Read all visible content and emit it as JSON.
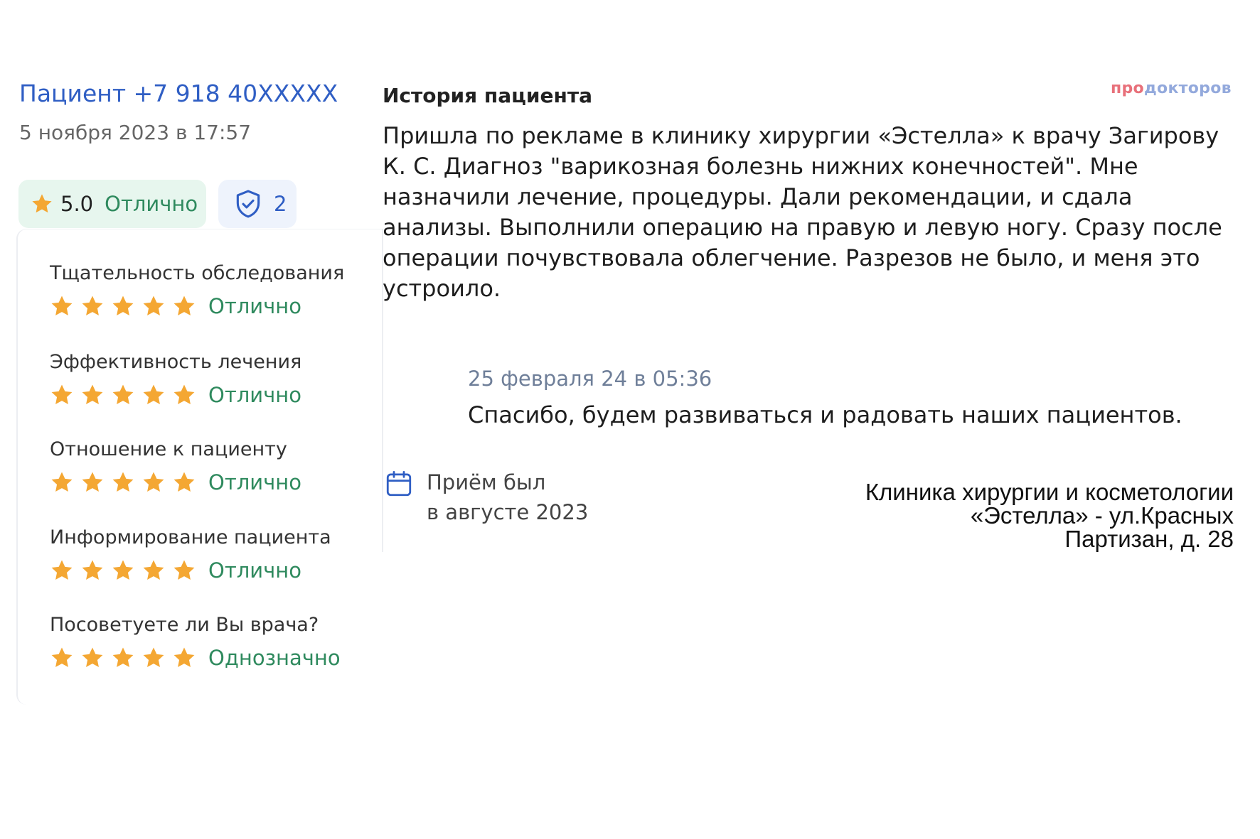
{
  "review": {
    "patient_name": "Пациент +7 918 40XXXXX",
    "date": "5 ноября 2023 в 17:57",
    "overall_rating": "5.0",
    "overall_word": "Отлично",
    "verified_count": "2"
  },
  "criteria": [
    {
      "label": "Тщательность обследования",
      "stars": 5,
      "word": "Отлично"
    },
    {
      "label": "Эффективность лечения",
      "stars": 5,
      "word": "Отлично"
    },
    {
      "label": "Отношение к пациенту",
      "stars": 5,
      "word": "Отлично"
    },
    {
      "label": "Информирование пациента",
      "stars": 5,
      "word": "Отлично"
    },
    {
      "label": "Посоветуете ли Вы врача?",
      "stars": 5,
      "word": "Однозначно"
    }
  ],
  "history": {
    "title": "История пациента",
    "text": "Пришла по рекламе в клинику хирургии «Эстелла» к врачу Загирову К. С. Диагноз \"варикозная болезнь нижних конечностей\". Мне назначили лечение, процедуры. Дали рекомендации, и сдала анализы. Выполнили операцию на правую и левую ногу. Сразу после операции почувствовала облегчение. Разрезов не было, и меня это устроило."
  },
  "brand": {
    "part1": "про",
    "part2": "докторов"
  },
  "reply": {
    "date": "25 февраля 24 в 05:36",
    "text": "Спасибо, будем развиваться и радовать наших пациентов."
  },
  "visit": {
    "line1": "Приём был",
    "line2": "в августе 2023"
  },
  "clinic": {
    "line1": "Клиника хирургии и косметологии",
    "line2": "«Эстелла» - ул.Красных",
    "line3": "Партизан, д. 28"
  },
  "colors": {
    "link_blue": "#2f5ec4",
    "rating_green": "#2f8a5e",
    "star_orange": "#f4a733",
    "badge_green_bg": "#e7f6ee",
    "badge_blue_bg": "#eef3fc"
  },
  "icons": [
    "star-icon",
    "shield-check-icon",
    "calendar-icon"
  ]
}
